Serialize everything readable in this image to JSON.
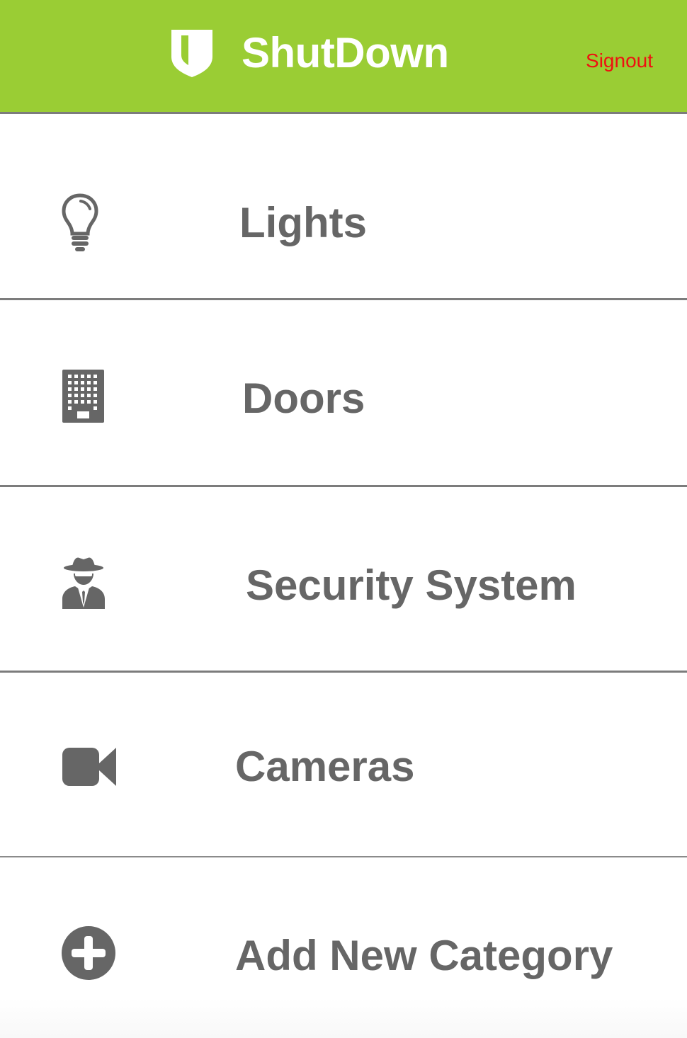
{
  "header": {
    "title": "ShutDown",
    "signout_label": "Signout",
    "logo_icon": "shield-icon",
    "background_color": "#9acd34",
    "signout_color": "#ee1111"
  },
  "menu": {
    "items": [
      {
        "label": "Lights",
        "icon": "lightbulb-icon"
      },
      {
        "label": "Doors",
        "icon": "building-icon"
      },
      {
        "label": "Security System",
        "icon": "spy-icon"
      },
      {
        "label": "Cameras",
        "icon": "video-camera-icon"
      },
      {
        "label": "Add New Category",
        "icon": "plus-circle-icon"
      }
    ]
  },
  "colors": {
    "text": "#666666",
    "divider": "#7c7c7c"
  }
}
